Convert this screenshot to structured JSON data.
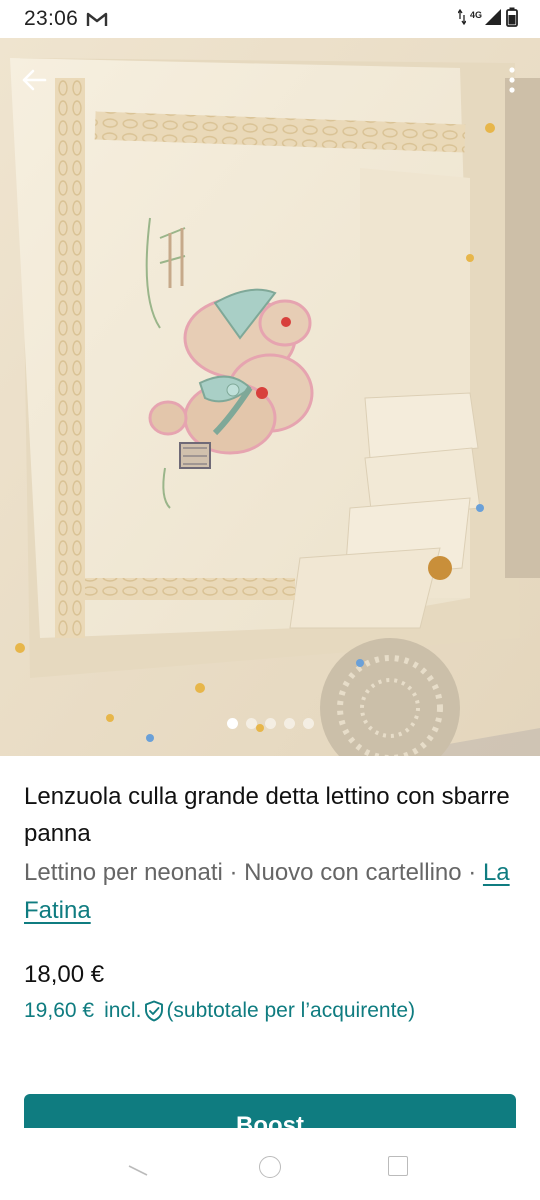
{
  "status_bar": {
    "time": "23:06",
    "network": "4G",
    "icons": [
      "gmail-icon",
      "data-arrows-icon",
      "signal-icon",
      "battery-icon"
    ]
  },
  "hero": {
    "image_description_icon": "photo",
    "page_count": 5,
    "active_page": 1,
    "icons": [
      "back-arrow-icon",
      "more-vertical-icon"
    ]
  },
  "item": {
    "title": "Lenzuola culla grande detta lettino con sbarre panna",
    "meta_prefix": "Lettino per neonati · Nuovo con cartellino · ",
    "brand": "La Fatina",
    "price": "18,00 €",
    "price_incl_amount": "19,60 €",
    "price_incl_label": "incl.",
    "price_incl_note": "(subtotale per l’acquirente)"
  },
  "actions": {
    "boost_label": "Boost"
  },
  "colors": {
    "accent": "#0f7c80",
    "meta_text": "#666666"
  }
}
